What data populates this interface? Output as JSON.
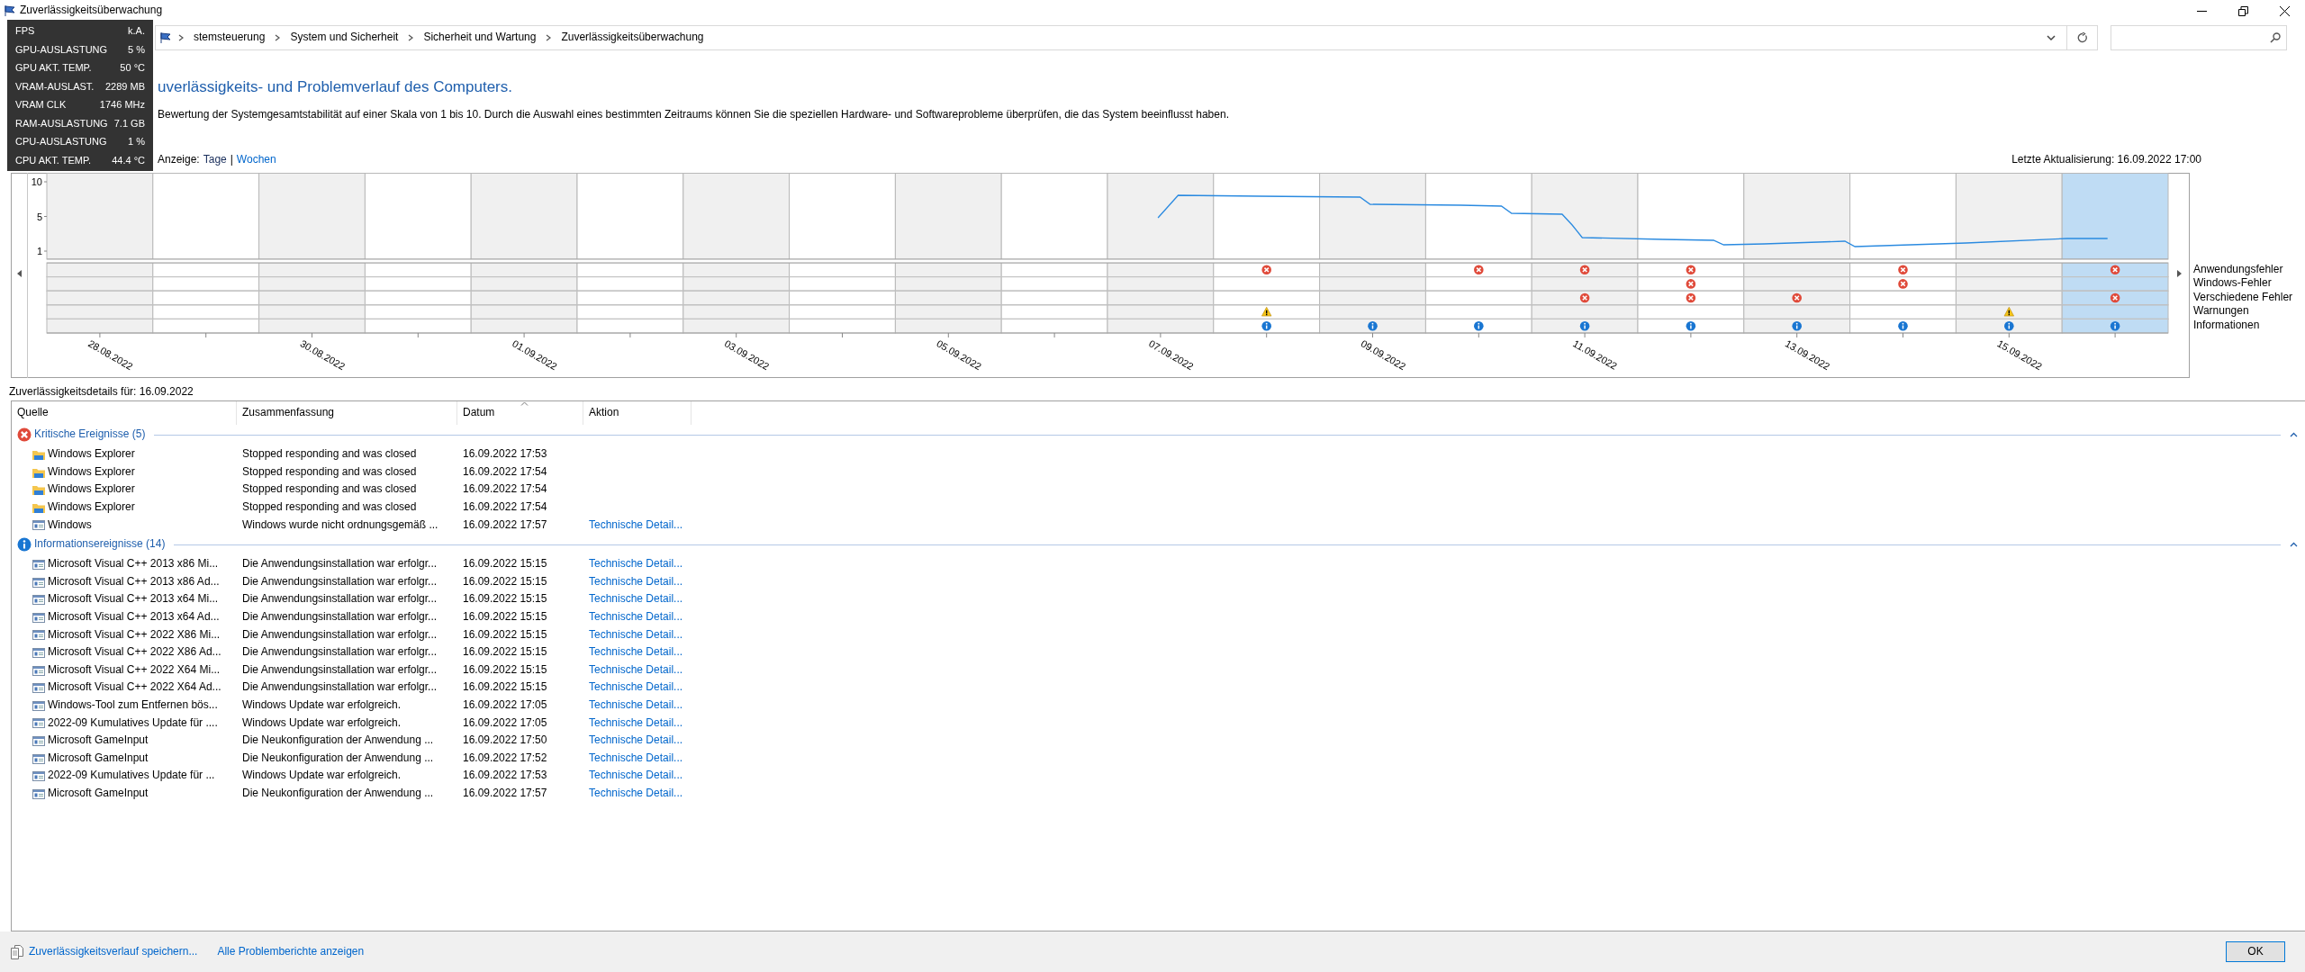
{
  "window": {
    "title": "Zuverlässigkeitsüberwachung"
  },
  "overlay": [
    {
      "label": "FPS",
      "value": "k.A."
    },
    {
      "label": "GPU-AUSLASTUNG",
      "value": "5 %"
    },
    {
      "label": "GPU AKT. TEMP.",
      "value": "50 °C"
    },
    {
      "label": "VRAM-AUSLAST.",
      "value": "2289 MB"
    },
    {
      "label": "VRAM CLK",
      "value": "1746 MHz"
    },
    {
      "label": "RAM-AUSLASTUNG",
      "value": "7.1 GB"
    },
    {
      "label": "CPU-AUSLASTUNG",
      "value": "1 %"
    },
    {
      "label": "CPU AKT. TEMP.",
      "value": "44.4 °C"
    }
  ],
  "breadcrumb": [
    "stemsteuerung",
    "System und Sicherheit",
    "Sicherheit und Wartung",
    "Zuverlässigkeitsüberwachung"
  ],
  "heading": "uverlässigkeits- und Problemverlauf des Computers.",
  "description": "Bewertung der Systemgesamtstabilität auf einer Skala von 1 bis 10. Durch die Auswahl eines bestimmten Zeitraums können Sie die speziellen Hardware- und Softwareprobleme überprüfen, die das System beeinflusst haben.",
  "view": {
    "label": "Anzeige:",
    "separator": "|",
    "options": [
      {
        "label": "Tage",
        "selected": true
      },
      {
        "label": "Wochen",
        "selected": false
      }
    ]
  },
  "last_update": "Letzte Aktualisierung: 16.09.2022 17:00",
  "stability_chart": {
    "y_axis_labels": [
      "10",
      "5",
      "1"
    ],
    "date_labels": [
      "28.08.2022",
      "30.08.2022",
      "01.09.2022",
      "03.09.2022",
      "05.09.2022",
      "07.09.2022",
      "09.09.2022",
      "11.09.2022",
      "13.09.2022",
      "15.09.2022"
    ]
  },
  "days": [
    {
      "selected": false
    },
    {
      "selected": false
    },
    {
      "selected": false
    },
    {
      "selected": false
    },
    {
      "selected": false
    },
    {
      "selected": false
    },
    {
      "selected": false
    },
    {
      "selected": false
    },
    {
      "selected": false
    },
    {
      "selected": false
    },
    {
      "selected": false
    },
    {
      "selected": false
    },
    {
      "selected": false
    },
    {
      "selected": false
    },
    {
      "selected": false
    },
    {
      "selected": false
    },
    {
      "selected": false
    },
    {
      "selected": false
    },
    {
      "selected": false
    },
    {
      "selected": true
    }
  ],
  "legend": [
    {
      "kind": "app_error",
      "label": "Anwendungsfehler",
      "marked": [
        false,
        false,
        false,
        false,
        false,
        false,
        false,
        false,
        false,
        false,
        false,
        true,
        false,
        true,
        true,
        true,
        false,
        true,
        false,
        true
      ]
    },
    {
      "kind": "windows_error",
      "label": "Windows-Fehler",
      "marked": [
        false,
        false,
        false,
        false,
        false,
        false,
        false,
        false,
        false,
        false,
        false,
        false,
        false,
        false,
        false,
        true,
        false,
        true,
        false,
        false
      ]
    },
    {
      "kind": "misc_error",
      "label": "Verschiedene Fehler",
      "marked": [
        false,
        false,
        false,
        false,
        false,
        false,
        false,
        false,
        false,
        false,
        false,
        false,
        false,
        false,
        true,
        true,
        true,
        false,
        false,
        true
      ]
    },
    {
      "kind": "warning",
      "label": "Warnungen",
      "marked": [
        false,
        false,
        false,
        false,
        false,
        false,
        false,
        false,
        false,
        false,
        false,
        true,
        false,
        false,
        false,
        false,
        false,
        false,
        true,
        false
      ]
    },
    {
      "kind": "info",
      "label": "Informationen",
      "marked": [
        false,
        false,
        false,
        false,
        false,
        false,
        false,
        false,
        false,
        false,
        false,
        true,
        true,
        true,
        true,
        true,
        true,
        true,
        true,
        true
      ]
    }
  ],
  "details_title": "Zuverlässigkeitsdetails für: 16.09.2022",
  "table": {
    "columns": [
      {
        "label": "Quelle",
        "sorted": false
      },
      {
        "label": "Zusammenfassung",
        "sorted": false
      },
      {
        "label": "Datum",
        "sorted": true
      },
      {
        "label": "Aktion",
        "sorted": false
      }
    ],
    "groups": [
      {
        "kind": "critical",
        "title": "Kritische Ereignisse (5)",
        "expanded": true,
        "rows": [
          {
            "kind": "explorer",
            "source": "Windows Explorer",
            "summary": "Stopped responding and was closed",
            "date": "16.09.2022 17:53"
          },
          {
            "kind": "explorer",
            "source": "Windows Explorer",
            "summary": "Stopped responding and was closed",
            "date": "16.09.2022 17:54"
          },
          {
            "kind": "explorer",
            "source": "Windows Explorer",
            "summary": "Stopped responding and was closed",
            "date": "16.09.2022 17:54"
          },
          {
            "kind": "explorer",
            "source": "Windows Explorer",
            "summary": "Stopped responding and was closed",
            "date": "16.09.2022 17:54"
          },
          {
            "kind": "app",
            "source": "Windows",
            "summary": "Windows wurde nicht ordnungsgemäß ...",
            "date": "16.09.2022 17:57",
            "action": "Technische Detail..."
          }
        ]
      },
      {
        "kind": "info",
        "title": "Informationsereignisse (14)",
        "expanded": true,
        "rows": [
          {
            "kind": "app",
            "source": "Microsoft Visual C++ 2013 x86 Mi...",
            "summary": "Die Anwendungsinstallation war erfolgr...",
            "date": "16.09.2022 15:15",
            "action": "Technische Detail..."
          },
          {
            "kind": "app",
            "source": "Microsoft Visual C++ 2013 x86 Ad...",
            "summary": "Die Anwendungsinstallation war erfolgr...",
            "date": "16.09.2022 15:15",
            "action": "Technische Detail..."
          },
          {
            "kind": "app",
            "source": "Microsoft Visual C++ 2013 x64 Mi...",
            "summary": "Die Anwendungsinstallation war erfolgr...",
            "date": "16.09.2022 15:15",
            "action": "Technische Detail..."
          },
          {
            "kind": "app",
            "source": "Microsoft Visual C++ 2013 x64 Ad...",
            "summary": "Die Anwendungsinstallation war erfolgr...",
            "date": "16.09.2022 15:15",
            "action": "Technische Detail..."
          },
          {
            "kind": "app",
            "source": "Microsoft Visual C++ 2022 X86 Mi...",
            "summary": "Die Anwendungsinstallation war erfolgr...",
            "date": "16.09.2022 15:15",
            "action": "Technische Detail..."
          },
          {
            "kind": "app",
            "source": "Microsoft Visual C++ 2022 X86 Ad...",
            "summary": "Die Anwendungsinstallation war erfolgr...",
            "date": "16.09.2022 15:15",
            "action": "Technische Detail..."
          },
          {
            "kind": "app",
            "source": "Microsoft Visual C++ 2022 X64 Mi...",
            "summary": "Die Anwendungsinstallation war erfolgr...",
            "date": "16.09.2022 15:15",
            "action": "Technische Detail..."
          },
          {
            "kind": "app",
            "source": "Microsoft Visual C++ 2022 X64 Ad...",
            "summary": "Die Anwendungsinstallation war erfolgr...",
            "date": "16.09.2022 15:15",
            "action": "Technische Detail..."
          },
          {
            "kind": "app",
            "source": "Windows-Tool zum Entfernen bös...",
            "summary": "Windows Update war erfolgreich.",
            "date": "16.09.2022 17:05",
            "action": "Technische Detail..."
          },
          {
            "kind": "app",
            "source": "2022-09 Kumulatives Update für ....",
            "summary": "Windows Update war erfolgreich.",
            "date": "16.09.2022 17:05",
            "action": "Technische Detail..."
          },
          {
            "kind": "app",
            "source": "Microsoft GameInput",
            "summary": "Die Neukonfiguration der Anwendung ...",
            "date": "16.09.2022 17:50",
            "action": "Technische Detail..."
          },
          {
            "kind": "app",
            "source": "Microsoft GameInput",
            "summary": "Die Neukonfiguration der Anwendung ...",
            "date": "16.09.2022 17:52",
            "action": "Technische Detail..."
          },
          {
            "kind": "app",
            "source": "2022-09 Kumulatives Update für ...",
            "summary": "Windows Update war erfolgreich.",
            "date": "16.09.2022 17:53",
            "action": "Technische Detail..."
          },
          {
            "kind": "app",
            "source": "Microsoft GameInput",
            "summary": "Die Neukonfiguration der Anwendung ...",
            "date": "16.09.2022 17:57",
            "action": "Technische Detail..."
          }
        ]
      }
    ]
  },
  "footer": {
    "links": [
      {
        "kind": "save",
        "label": "Zuverlässigkeitsverlauf speichern..."
      },
      {
        "kind": "link",
        "label": "Alle Problemberichte anzeigen"
      }
    ],
    "ok_button": "OK"
  }
}
